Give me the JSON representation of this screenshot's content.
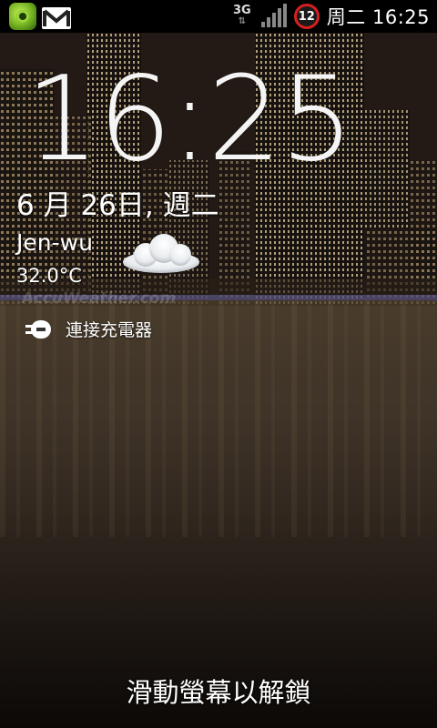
{
  "status_bar": {
    "network_type": "3G",
    "notification_count": "12",
    "time": "周二 16:25",
    "icons": [
      "app-shield-icon",
      "gmail-icon",
      "signal-strength-icon"
    ]
  },
  "lock_screen": {
    "clock": "16:25",
    "date": "6 月 26日, 週二",
    "weather": {
      "city": "Jen-wu",
      "temperature": "32.0°C",
      "condition_icon": "cloud-icon",
      "provider": "AccuWeather.com"
    },
    "charging": {
      "label": "連接充電器",
      "icon": "charger-plug-icon"
    },
    "unlock_hint": "滑動螢幕以解鎖"
  },
  "colors": {
    "status_bar_bg": "#000000",
    "notification_badge": "#d71f1f",
    "text": "#ffffff"
  }
}
